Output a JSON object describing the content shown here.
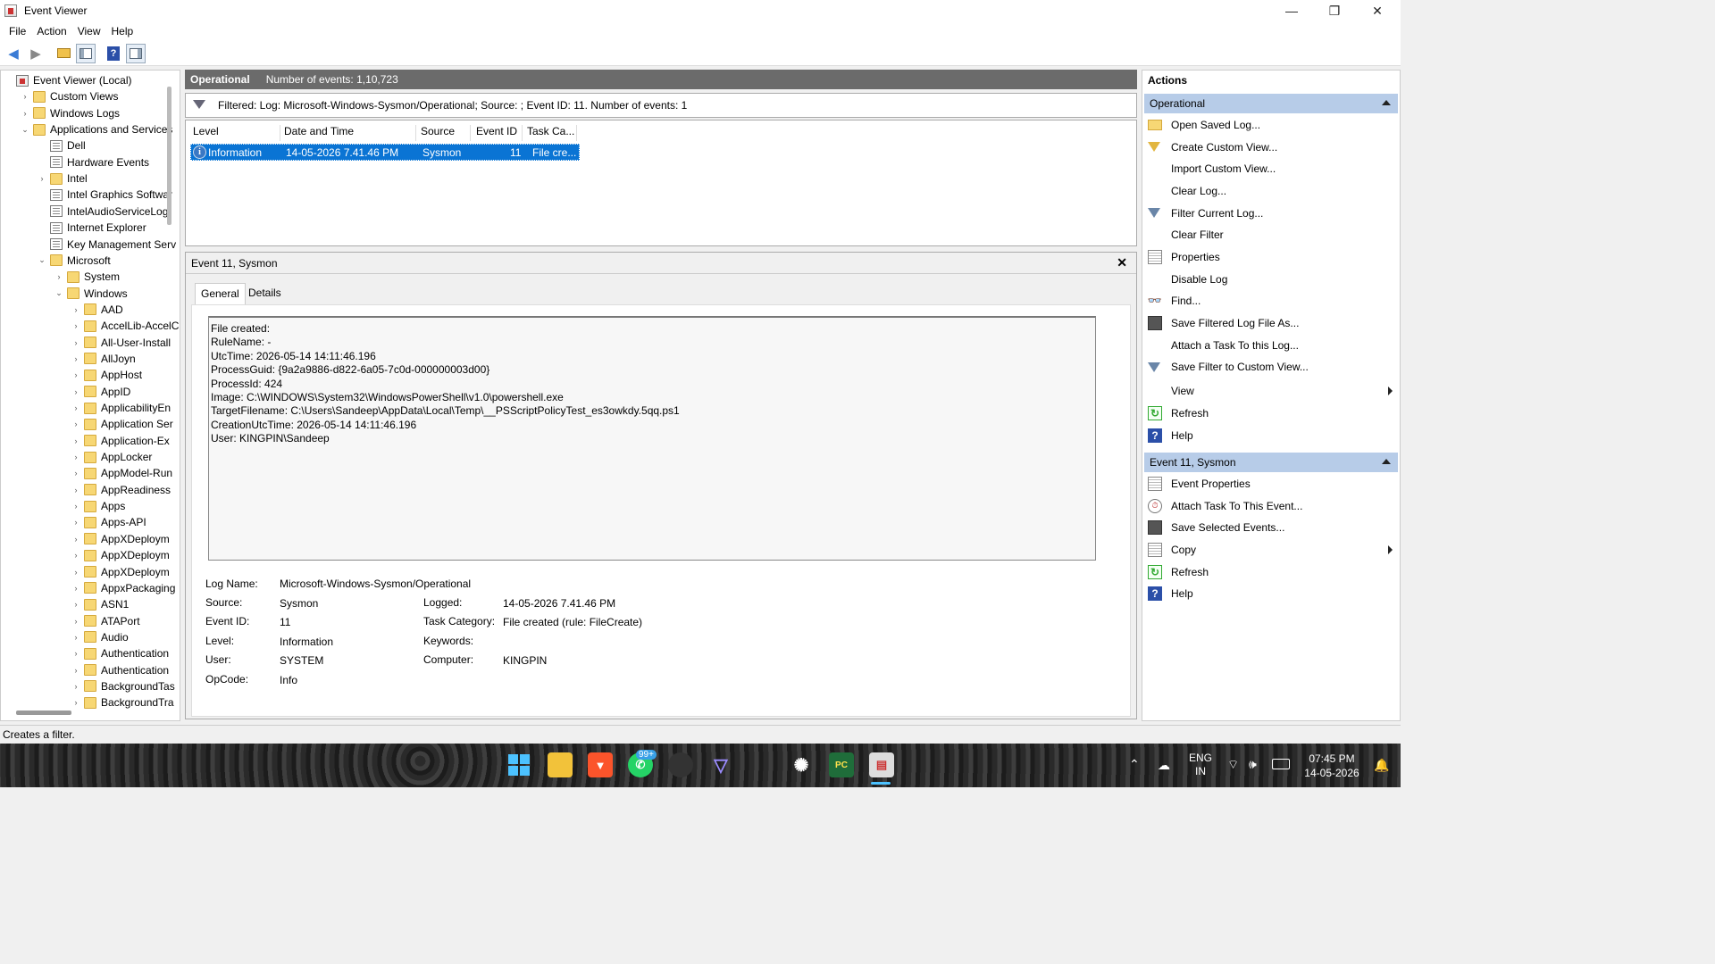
{
  "window": {
    "title": "Event Viewer",
    "minimize": "—",
    "maximize": "❐",
    "close": "✕"
  },
  "menu": [
    "File",
    "Action",
    "View",
    "Help"
  ],
  "toolbar_icons": [
    "back-icon",
    "forward-icon",
    "up-folder-icon",
    "show-hide-tree-icon",
    "help-icon",
    "show-hide-action-pane-icon"
  ],
  "tree": [
    {
      "label": "Event Viewer (Local)",
      "icon": "root",
      "exp": "",
      "indent": 0
    },
    {
      "label": "Custom Views",
      "icon": "folder",
      "exp": "›",
      "indent": 1
    },
    {
      "label": "Windows Logs",
      "icon": "folder",
      "exp": "›",
      "indent": 1
    },
    {
      "label": "Applications and Services",
      "icon": "folder",
      "exp": "⌄",
      "indent": 1
    },
    {
      "label": "Dell",
      "icon": "log",
      "exp": "",
      "indent": 2
    },
    {
      "label": "Hardware Events",
      "icon": "log",
      "exp": "",
      "indent": 2
    },
    {
      "label": "Intel",
      "icon": "folder",
      "exp": "›",
      "indent": 2
    },
    {
      "label": "Intel Graphics Softwar",
      "icon": "log",
      "exp": "",
      "indent": 2
    },
    {
      "label": "IntelAudioServiceLog",
      "icon": "log",
      "exp": "",
      "indent": 2
    },
    {
      "label": "Internet Explorer",
      "icon": "log",
      "exp": "",
      "indent": 2
    },
    {
      "label": "Key Management Serv",
      "icon": "log",
      "exp": "",
      "indent": 2
    },
    {
      "label": "Microsoft",
      "icon": "folder",
      "exp": "⌄",
      "indent": 2
    },
    {
      "label": "System",
      "icon": "folder",
      "exp": "›",
      "indent": 3
    },
    {
      "label": "Windows",
      "icon": "folder",
      "exp": "⌄",
      "indent": 3
    },
    {
      "label": "AAD",
      "icon": "folder",
      "exp": "›",
      "indent": 4
    },
    {
      "label": "AccelLib-AccelC",
      "icon": "folder",
      "exp": "›",
      "indent": 4
    },
    {
      "label": "All-User-Install",
      "icon": "folder",
      "exp": "›",
      "indent": 4
    },
    {
      "label": "AllJoyn",
      "icon": "folder",
      "exp": "›",
      "indent": 4
    },
    {
      "label": "AppHost",
      "icon": "folder",
      "exp": "›",
      "indent": 4
    },
    {
      "label": "AppID",
      "icon": "folder",
      "exp": "›",
      "indent": 4
    },
    {
      "label": "ApplicabilityEn",
      "icon": "folder",
      "exp": "›",
      "indent": 4
    },
    {
      "label": "Application Ser",
      "icon": "folder",
      "exp": "›",
      "indent": 4
    },
    {
      "label": "Application-Ex",
      "icon": "folder",
      "exp": "›",
      "indent": 4
    },
    {
      "label": "AppLocker",
      "icon": "folder",
      "exp": "›",
      "indent": 4
    },
    {
      "label": "AppModel-Run",
      "icon": "folder",
      "exp": "›",
      "indent": 4
    },
    {
      "label": "AppReadiness",
      "icon": "folder",
      "exp": "›",
      "indent": 4
    },
    {
      "label": "Apps",
      "icon": "folder",
      "exp": "›",
      "indent": 4
    },
    {
      "label": "Apps-API",
      "icon": "folder",
      "exp": "›",
      "indent": 4
    },
    {
      "label": "AppXDeploym",
      "icon": "folder",
      "exp": "›",
      "indent": 4
    },
    {
      "label": "AppXDeploym",
      "icon": "folder",
      "exp": "›",
      "indent": 4
    },
    {
      "label": "AppXDeploym",
      "icon": "folder",
      "exp": "›",
      "indent": 4
    },
    {
      "label": "AppxPackaging",
      "icon": "folder",
      "exp": "›",
      "indent": 4
    },
    {
      "label": "ASN1",
      "icon": "folder",
      "exp": "›",
      "indent": 4
    },
    {
      "label": "ATAPort",
      "icon": "folder",
      "exp": "›",
      "indent": 4
    },
    {
      "label": "Audio",
      "icon": "folder",
      "exp": "›",
      "indent": 4
    },
    {
      "label": "Authentication",
      "icon": "folder",
      "exp": "›",
      "indent": 4
    },
    {
      "label": "Authentication",
      "icon": "folder",
      "exp": "›",
      "indent": 4
    },
    {
      "label": "BackgroundTas",
      "icon": "folder",
      "exp": "›",
      "indent": 4
    },
    {
      "label": "BackgroundTra",
      "icon": "folder",
      "exp": "›",
      "indent": 4
    }
  ],
  "log": {
    "name": "Operational",
    "count": "Number of events: 1,10,723"
  },
  "filter": "Filtered: Log: Microsoft-Windows-Sysmon/Operational; Source: ; Event ID: 11. Number of events: 1",
  "grid": {
    "columns": [
      "Level",
      "Date and Time",
      "Source",
      "Event ID",
      "Task Ca..."
    ],
    "row": {
      "level": "Information",
      "datetime": "14-05-2026 7.41.46 PM",
      "source": "Sysmon",
      "event_id": "11",
      "task": "File cre..."
    }
  },
  "detail": {
    "header": "Event 11, Sysmon",
    "tabs": [
      "General",
      "Details"
    ],
    "message": "File created:\nRuleName: -\nUtcTime: 2026-05-14 14:11:46.196\nProcessGuid: {9a2a9886-d822-6a05-7c0d-000000003d00}\nProcessId: 424\nImage: C:\\WINDOWS\\System32\\WindowsPowerShell\\v1.0\\powershell.exe\nTargetFilename: C:\\Users\\Sandeep\\AppData\\Local\\Temp\\__PSScriptPolicyTest_es3owkdy.5qq.ps1\nCreationUtcTime: 2026-05-14 14:11:46.196\nUser: KINGPIN\\Sandeep",
    "log_name_label": "Log Name:",
    "log_name": "Microsoft-Windows-Sysmon/Operational",
    "source_label": "Source:",
    "source": "Sysmon",
    "logged_label": "Logged:",
    "logged": "14-05-2026 7.41.46 PM",
    "event_id_label": "Event ID:",
    "event_id": "11",
    "task_label": "Task Category:",
    "task": "File created (rule: FileCreate)",
    "level_label": "Level:",
    "level": "Information",
    "keywords_label": "Keywords:",
    "keywords": "",
    "user_label": "User:",
    "user": "SYSTEM",
    "computer_label": "Computer:",
    "computer": "KINGPIN",
    "opcode_label": "OpCode:",
    "opcode": "Info"
  },
  "actions": {
    "title": "Actions",
    "section1": "Operational",
    "items1": [
      {
        "label": "Open Saved Log...",
        "icon": "open-folder-icon",
        "cls": "fold",
        "glyph": "",
        "sub": false
      },
      {
        "label": "Create Custom View...",
        "icon": "funnel-icon",
        "cls": "funnel",
        "glyph": "",
        "sub": false
      },
      {
        "label": "Import Custom View...",
        "icon": "",
        "cls": "",
        "glyph": "",
        "sub": false
      },
      {
        "label": "Clear Log...",
        "icon": "",
        "cls": "",
        "glyph": "",
        "sub": false
      },
      {
        "label": "Filter Current Log...",
        "icon": "filter-icon",
        "cls": "funnel2",
        "glyph": "",
        "sub": false
      },
      {
        "label": "Clear Filter",
        "icon": "",
        "cls": "",
        "glyph": "",
        "sub": false
      },
      {
        "label": "Properties",
        "icon": "properties-icon",
        "cls": "doc",
        "glyph": "",
        "sub": false
      },
      {
        "label": "Disable Log",
        "icon": "",
        "cls": "",
        "glyph": "",
        "sub": false
      },
      {
        "label": "Find...",
        "icon": "binoculars-icon",
        "cls": "bino",
        "glyph": "👓",
        "sub": false
      },
      {
        "label": "Save Filtered Log File As...",
        "icon": "save-icon",
        "cls": "disk",
        "glyph": "",
        "sub": false
      },
      {
        "label": "Attach a Task To this Log...",
        "icon": "",
        "cls": "",
        "glyph": "",
        "sub": false
      },
      {
        "label": "Save Filter to Custom View...",
        "icon": "save-filter-icon",
        "cls": "funnel2",
        "glyph": "",
        "sub": false
      },
      {
        "label": "View",
        "icon": "",
        "cls": "",
        "glyph": "",
        "sub": true
      },
      {
        "label": "Refresh",
        "icon": "refresh-icon",
        "cls": "refresh",
        "glyph": "↻",
        "sub": false
      },
      {
        "label": "Help",
        "icon": "help-icon",
        "cls": "help",
        "glyph": "?",
        "sub": false
      }
    ],
    "section2": "Event 11, Sysmon",
    "items2": [
      {
        "label": "Event Properties",
        "icon": "event-properties-icon",
        "cls": "doc",
        "glyph": "",
        "sub": false
      },
      {
        "label": "Attach Task To This Event...",
        "icon": "task-icon",
        "cls": "task",
        "glyph": "⏱",
        "sub": false
      },
      {
        "label": "Save Selected Events...",
        "icon": "save-icon",
        "cls": "disk",
        "glyph": "",
        "sub": false
      },
      {
        "label": "Copy",
        "icon": "copy-icon",
        "cls": "doc",
        "glyph": "",
        "sub": true
      },
      {
        "label": "Refresh",
        "icon": "refresh-icon",
        "cls": "refresh",
        "glyph": "↻",
        "sub": false
      },
      {
        "label": "Help",
        "icon": "help-icon",
        "cls": "help",
        "glyph": "?",
        "sub": false
      }
    ]
  },
  "status": "Creates a filter.",
  "taskbar": {
    "badge": "99+",
    "lang1": "ENG",
    "lang2": "IN",
    "time": "07:45 PM",
    "date": "14-05-2026"
  }
}
